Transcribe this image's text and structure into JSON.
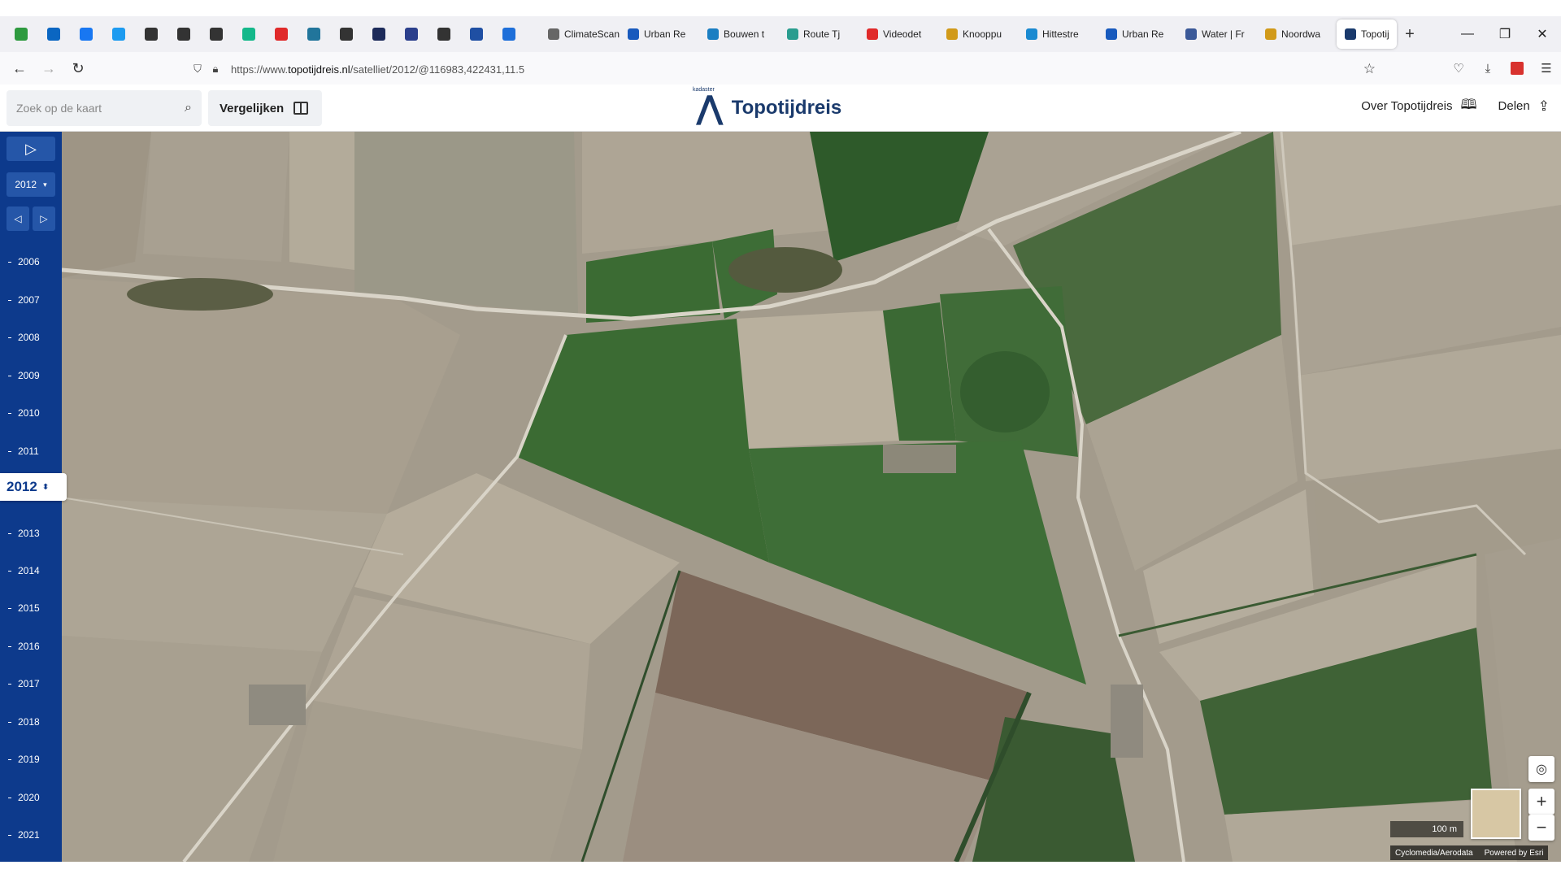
{
  "browser": {
    "bookmark_icons": [
      {
        "name": "green-circle-icon",
        "color": "#2e9a3f"
      },
      {
        "name": "linkedin-icon",
        "color": "#0a66c2"
      },
      {
        "name": "facebook-icon",
        "color": "#1877f2"
      },
      {
        "name": "twitter-icon",
        "color": "#1d9bf0"
      },
      {
        "name": "globe-icon",
        "color": "#333333"
      },
      {
        "name": "globe-icon",
        "color": "#333333"
      },
      {
        "name": "globe-icon",
        "color": "#333333"
      },
      {
        "name": "green-r-icon",
        "color": "#14b88a"
      },
      {
        "name": "red-camera-icon",
        "color": "#e02a2a"
      },
      {
        "name": "wordpress-icon",
        "color": "#21759b"
      },
      {
        "name": "info-circle-icon",
        "color": "#333333"
      },
      {
        "name": "dark-circle-icon",
        "color": "#1d2b5a"
      },
      {
        "name": "blue-circle-icon",
        "color": "#2b3f8c"
      },
      {
        "name": "info-circle-icon",
        "color": "#333333"
      },
      {
        "name": "p-square-icon",
        "color": "#1f4fa3"
      },
      {
        "name": "cloud-icon",
        "color": "#1e6fd9"
      }
    ],
    "tabs": [
      {
        "label": "ClimateScan",
        "icon_color": "#666666"
      },
      {
        "label": "Urban Re",
        "icon_color": "#185abd"
      },
      {
        "label": "Bouwen t",
        "icon_color": "#1a7ec2"
      },
      {
        "label": "Route Tj",
        "icon_color": "#2a9d8f"
      },
      {
        "label": "Videodet",
        "icon_color": "#e02a2a"
      },
      {
        "label": "Knooppu",
        "icon_color": "#d19a1a"
      },
      {
        "label": "Hittestre",
        "icon_color": "#1a8ad1"
      },
      {
        "label": "Urban Re",
        "icon_color": "#185abd"
      },
      {
        "label": "Water | Fr",
        "icon_color": "#3b5998"
      },
      {
        "label": "Noordwa",
        "icon_color": "#d19a1a"
      }
    ],
    "active_tab": {
      "label": "Topotij",
      "icon_color": "#1a3a6c"
    },
    "new_tab": "+",
    "url_prefix": "https://www.",
    "url_domain": "topotijdreis.nl",
    "url_path": "/satelliet/2012/@116983,422431,11.5"
  },
  "app": {
    "search_placeholder": "Zoek op de kaart",
    "compare_label": "Vergelijken",
    "logo_small": "kadaster",
    "title": "Topotijdreis",
    "about_label": "Over Topotijdreis",
    "share_label": "Delen"
  },
  "timeline": {
    "selected_year_button": "2012",
    "current_year": "2012",
    "years": [
      "2006",
      "2007",
      "2008",
      "2009",
      "2010",
      "2011",
      "2013",
      "2014",
      "2015",
      "2016",
      "2017",
      "2018",
      "2019",
      "2020",
      "2021"
    ]
  },
  "map": {
    "scale_label": "100 m",
    "attribution_left": "Cyclomedia/Aerodata",
    "attribution_right": "Powered by Esri"
  },
  "colors": {
    "timeline_bg": "#0d3a8c",
    "brand": "#1a3a6c",
    "field_green_dark": "#2f5a2c",
    "field_green": "#3d6b35",
    "field_tan": "#a49c8c",
    "field_light": "#bcb4a4",
    "road": "#d9d4c8"
  }
}
